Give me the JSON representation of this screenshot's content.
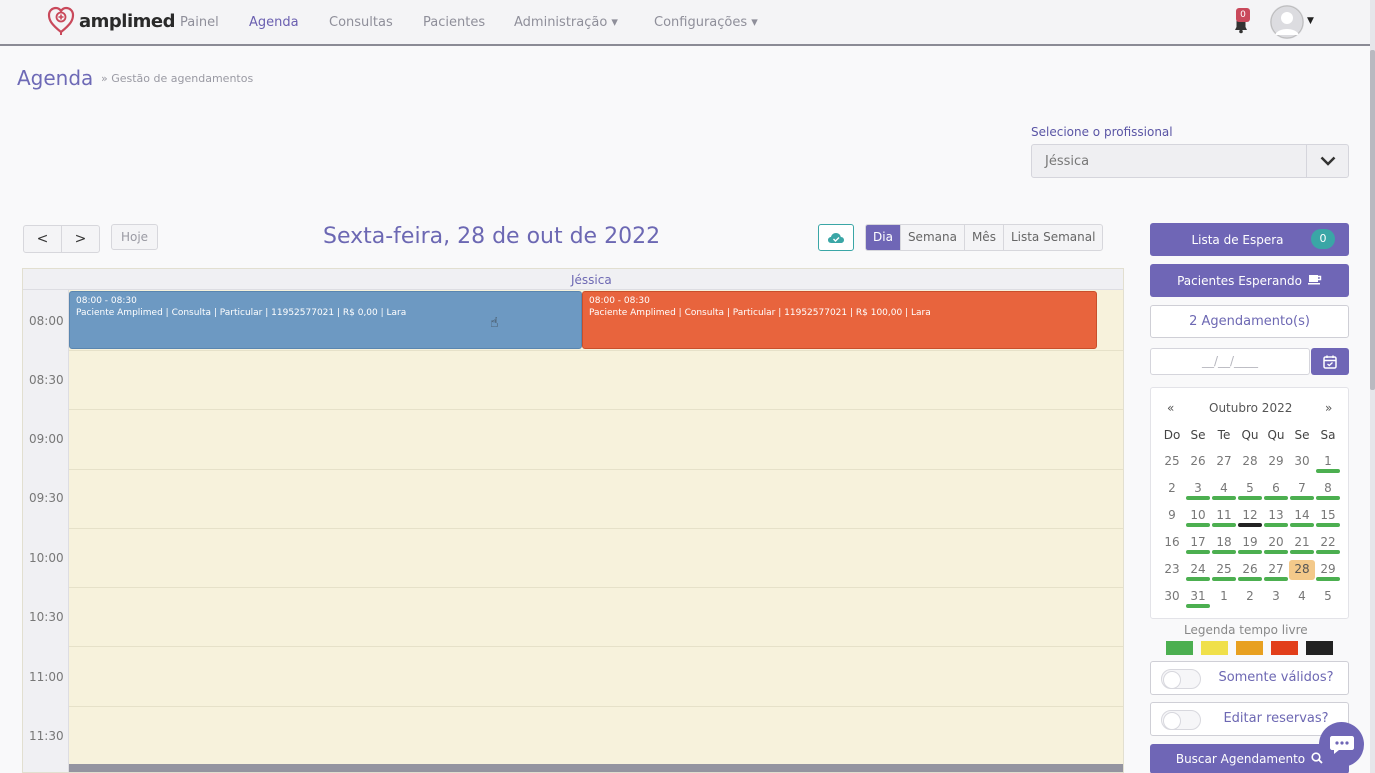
{
  "brand": {
    "name": "amplimed",
    "accent": "#6f66b6"
  },
  "nav": {
    "items": [
      {
        "label": "Painel",
        "active": false
      },
      {
        "label": "Agenda",
        "active": true
      },
      {
        "label": "Consultas",
        "active": false
      },
      {
        "label": "Pacientes",
        "active": false
      },
      {
        "label": "Administração ▾",
        "active": false
      },
      {
        "label": "Configurações ▾",
        "active": false
      }
    ],
    "notification_count": "0"
  },
  "page": {
    "title": "Agenda",
    "breadcrumb": "» Gestão de agendamentos"
  },
  "professional": {
    "label": "Selecione o profissional",
    "value": "Jéssica"
  },
  "toolbar": {
    "prev": "<",
    "next": ">",
    "today": "Hoje",
    "date_title": "Sexta-feira, 28 de out de 2022",
    "views": [
      "Dia",
      "Semana",
      "Mês",
      "Lista Semanal"
    ],
    "active_view": "Dia"
  },
  "calendar": {
    "column": "Jéssica",
    "times": [
      "08:00",
      "08:30",
      "09:00",
      "09:30",
      "10:00",
      "10:30",
      "11:00",
      "11:30"
    ],
    "events": [
      {
        "time": "08:00 - 08:30",
        "text": "Paciente Amplimed | Consulta | Particular | 11952577021 | R$ 0,00 | Lara",
        "color": "#6d99c2"
      },
      {
        "time": "08:00 - 08:30",
        "text": "Paciente Amplimed | Consulta | Particular | 11952577021 | R$ 100,00 | Lara",
        "color": "#e8643d"
      }
    ]
  },
  "sidebar": {
    "waitlist_label": "Lista de Espera",
    "waitlist_count": "0",
    "waiting_label": "Pacientes Esperando",
    "appointments_label": "2 Agendamento(s)",
    "date_placeholder": "__/__/____",
    "mini_calendar": {
      "month": "Outubro 2022",
      "prev": "«",
      "next": "»",
      "weekdays": [
        "Do",
        "Se",
        "Te",
        "Qu",
        "Qu",
        "Se",
        "Sa"
      ],
      "weeks": [
        [
          "25",
          "26",
          "27",
          "28",
          "29",
          "30",
          "1"
        ],
        [
          "2",
          "3",
          "4",
          "5",
          "6",
          "7",
          "8"
        ],
        [
          "9",
          "10",
          "11",
          "12",
          "13",
          "14",
          "15"
        ],
        [
          "16",
          "17",
          "18",
          "19",
          "20",
          "21",
          "22"
        ],
        [
          "23",
          "24",
          "25",
          "26",
          "27",
          "28",
          "29"
        ],
        [
          "30",
          "31",
          "1",
          "2",
          "3",
          "4",
          "5"
        ]
      ],
      "selected": "28"
    },
    "legend_title": "Legenda tempo livre",
    "legend_colors": [
      "#4caf50",
      "#f0e04a",
      "#e8a020",
      "#e23e1a",
      "#222222"
    ],
    "toggle_valid": "Somente válidos?",
    "toggle_reserves": "Editar reservas?",
    "search_label": "Buscar Agendamento"
  }
}
